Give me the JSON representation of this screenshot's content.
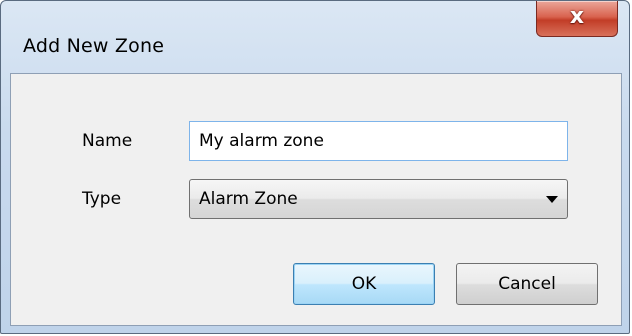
{
  "window": {
    "title": "Add New Zone",
    "close_glyph": "x",
    "close_icon": "close-icon"
  },
  "form": {
    "name_label": "Name",
    "name_value": "My alarm zone",
    "type_label": "Type",
    "type_selected": "Alarm Zone",
    "type_arrow_icon": "chevron-down-icon"
  },
  "buttons": {
    "ok_label": "OK",
    "cancel_label": "Cancel"
  },
  "colors": {
    "titlebar": "#c9daee",
    "close_button": "#d9634f",
    "client_bg": "#f0f0f0",
    "focus_border": "#7eb4ea",
    "default_button": "#bee6fd"
  }
}
